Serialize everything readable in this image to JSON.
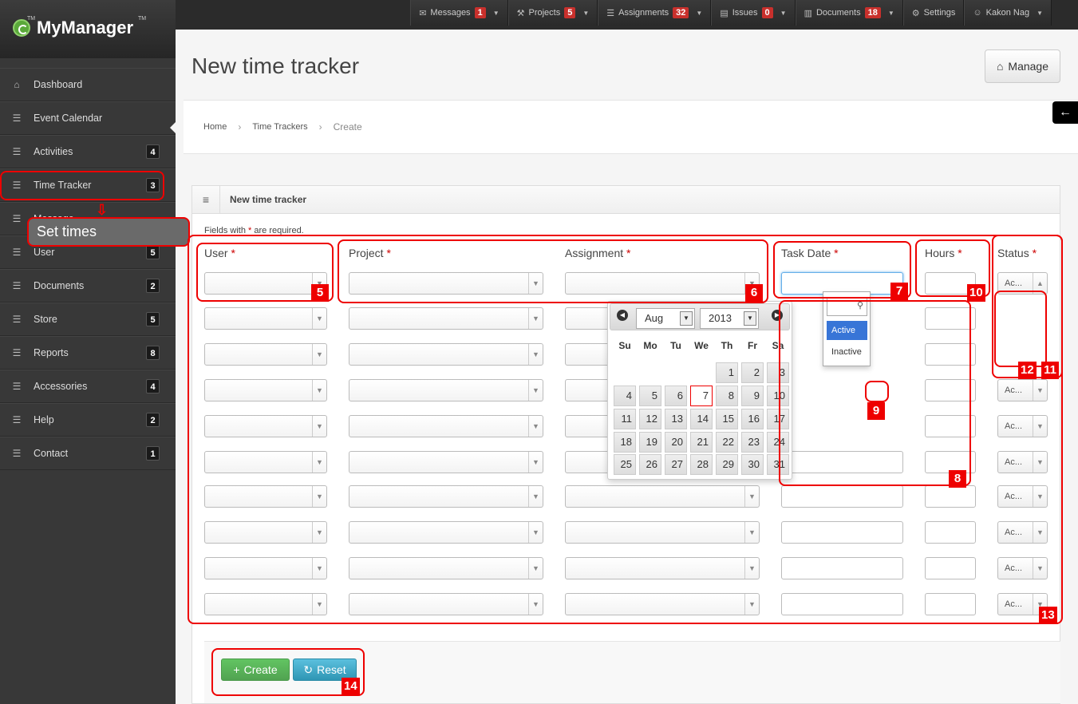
{
  "app": {
    "name": "MyManager",
    "tm": "TM"
  },
  "topnav": [
    {
      "label": "Messages",
      "badge": "1",
      "icon": "envelope-icon"
    },
    {
      "label": "Projects",
      "badge": "5",
      "icon": "wrench-icon"
    },
    {
      "label": "Assignments",
      "badge": "32",
      "icon": "list-icon"
    },
    {
      "label": "Issues",
      "badge": "0",
      "icon": "file-icon"
    },
    {
      "label": "Documents",
      "badge": "18",
      "icon": "book-icon"
    },
    {
      "label": "Settings",
      "badge": "",
      "icon": "gear-icon"
    },
    {
      "label": "Kakon Nag",
      "badge": "",
      "icon": "user-icon"
    }
  ],
  "sidebar": [
    {
      "label": "Dashboard",
      "badge": "",
      "icon": "home-icon"
    },
    {
      "label": "Event Calendar",
      "badge": "",
      "icon": "list-icon"
    },
    {
      "label": "Activities",
      "badge": "4",
      "icon": "list-icon"
    },
    {
      "label": "Time Tracker",
      "badge": "3",
      "icon": "list-icon"
    },
    {
      "label": "Message",
      "badge": "",
      "icon": "list-icon"
    },
    {
      "label": "User",
      "badge": "5",
      "icon": "list-icon"
    },
    {
      "label": "Documents",
      "badge": "2",
      "icon": "list-icon"
    },
    {
      "label": "Store",
      "badge": "5",
      "icon": "list-icon"
    },
    {
      "label": "Reports",
      "badge": "8",
      "icon": "list-icon"
    },
    {
      "label": "Accessories",
      "badge": "4",
      "icon": "list-icon"
    },
    {
      "label": "Help",
      "badge": "2",
      "icon": "list-icon"
    },
    {
      "label": "Contact",
      "badge": "1",
      "icon": "list-icon"
    }
  ],
  "tooltip": "Set times",
  "page": {
    "title": "New time tracker",
    "manage_label": "Manage",
    "breadcrumb": [
      "Home",
      "Time Trackers",
      "Create"
    ]
  },
  "form": {
    "panel_title": "New time tracker",
    "required_note": [
      "Fields with ",
      "*",
      " are required."
    ],
    "columns": {
      "user": "User",
      "project": "Project",
      "assignment": "Assignment",
      "task_date": "Task Date",
      "hours": "Hours",
      "status": "Status"
    },
    "required_star": "*",
    "status_value": "Ac...",
    "status_options": [
      "Active",
      "Inactive"
    ],
    "create_label": "Create",
    "reset_label": "Reset"
  },
  "datepicker": {
    "month": "Aug",
    "year": "2013",
    "dow": [
      "Su",
      "Mo",
      "Tu",
      "We",
      "Th",
      "Fr",
      "Sa"
    ],
    "days": [
      "1",
      "2",
      "3",
      "4",
      "5",
      "6",
      "7",
      "8",
      "9",
      "10",
      "11",
      "12",
      "13",
      "14",
      "15",
      "16",
      "17",
      "18",
      "19",
      "20",
      "21",
      "22",
      "23",
      "24",
      "25",
      "26",
      "27",
      "28",
      "29",
      "30",
      "31"
    ],
    "first_weekday": 4,
    "highlighted_day": "7"
  },
  "annotations": [
    "5",
    "6",
    "7",
    "8",
    "9",
    "10",
    "11",
    "12",
    "13",
    "14"
  ]
}
